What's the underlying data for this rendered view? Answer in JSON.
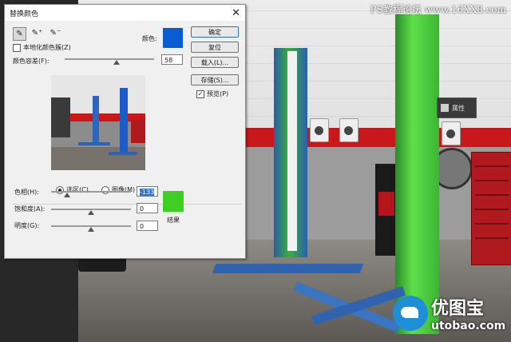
{
  "watermark": {
    "top_text": "PS教程论坛 www.16XX8.com",
    "logo_cn": "优图宝",
    "logo_en": "utobao.com"
  },
  "props_panel": {
    "label": "属性"
  },
  "dialog": {
    "title": "替换颜色",
    "localized_clusters_label": "本地化颜色簇(Z)",
    "color_label": "颜色:",
    "fuzziness_label": "颜色容差(F):",
    "fuzziness_value": "58",
    "fuzziness_fraction": 0.58,
    "color_swatch": "#0a5cd0",
    "selection_label": "选区(C)",
    "image_label": "图像(M)",
    "hue_label": "色相(H):",
    "hue_value": "-133",
    "saturation_label": "饱和度(A):",
    "saturation_value": "0",
    "lightness_label": "明度(G):",
    "lightness_value": "0",
    "result_label": "结果",
    "result_swatch": "#3ecf22",
    "buttons": {
      "ok": "确定",
      "reset": "复位",
      "load": "载入(L)...",
      "save": "存储(S)..."
    },
    "preview_label": "预览(P)"
  }
}
